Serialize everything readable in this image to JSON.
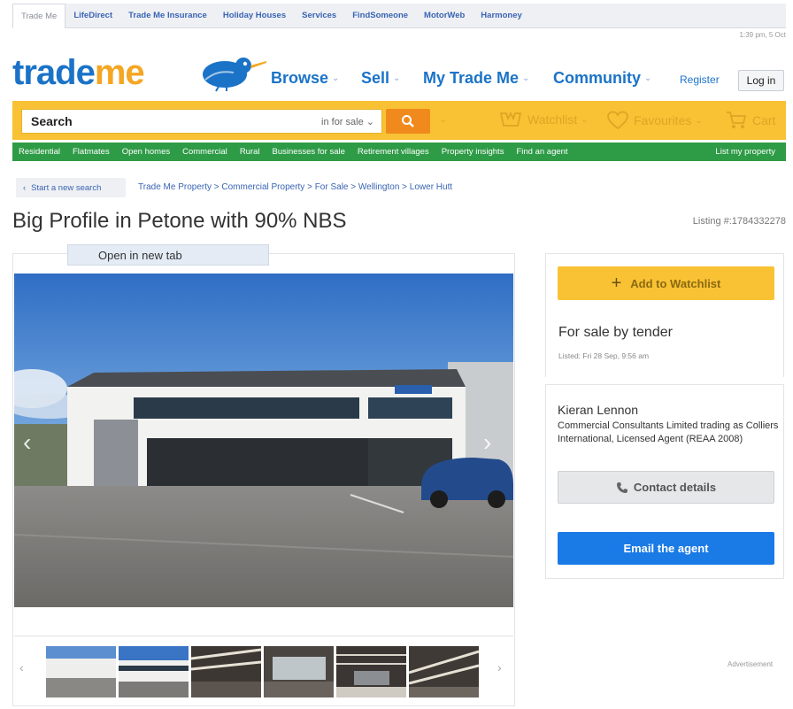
{
  "site_tabs": [
    "Trade Me",
    "LifeDirect",
    "Trade Me Insurance",
    "Holiday Houses",
    "Services",
    "FindSomeone",
    "MotorWeb",
    "Harmoney"
  ],
  "timestamp": "1:39 pm, 5 Oct",
  "logo": {
    "part1": "trade",
    "part2": "me"
  },
  "nav": {
    "browse": "Browse",
    "sell": "Sell",
    "my_trade_me": "My Trade Me",
    "community": "Community"
  },
  "account": {
    "register": "Register",
    "login": "Log in"
  },
  "search": {
    "label": "Search",
    "scope": "in for sale"
  },
  "header_links": {
    "watchlist": "Watchlist",
    "favourites": "Favourites",
    "cart": "Cart"
  },
  "categories": [
    "Residential",
    "Flatmates",
    "Open homes",
    "Commercial",
    "Rural",
    "Businesses for sale",
    "Retirement villages",
    "Property insights",
    "Find an agent"
  ],
  "list_property": "List my property",
  "back_link": "Start a new search",
  "breadcrumb": "Trade Me Property > Commercial Property > For Sale > Wellington > Lower Hutt",
  "listing": {
    "title": "Big Profile in Petone with 90% NBS",
    "number": "Listing #:1784332278",
    "open_tab": "Open in new tab",
    "watchlist_button": "Add to Watchlist",
    "sale_method": "For sale by tender",
    "listed_date": "Listed: Fri 28 Sep, 9:56 am"
  },
  "agent": {
    "name": "Kieran Lennon",
    "company": "Commercial Consultants Limited trading as Colliers International, Licensed Agent (REAA 2008)",
    "contact_button": "Contact details",
    "email_button": "Email the agent"
  },
  "advertisement": "Advertisement",
  "colors": {
    "brand_blue": "#1b73c7",
    "brand_orange": "#f5a623",
    "search_yellow": "#f8c234",
    "category_green": "#2e9b46",
    "email_blue": "#1a7ae6"
  },
  "icons": [
    "kiwi-logo-icon",
    "search-icon",
    "watchlist-icon",
    "heart-icon",
    "cart-icon",
    "phone-icon",
    "chevron-left-icon",
    "chevron-right-icon",
    "plus-icon"
  ]
}
